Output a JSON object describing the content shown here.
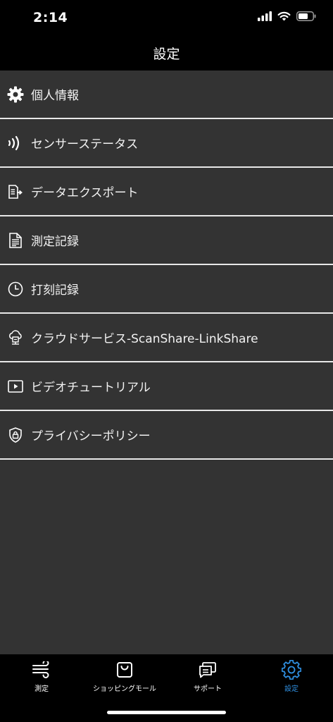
{
  "status_bar": {
    "time": "2:14"
  },
  "nav": {
    "title": "設定"
  },
  "menu": [
    {
      "label": "個人情報",
      "icon": "gear-icon"
    },
    {
      "label": "センサーステータス",
      "icon": "signal-waves-icon"
    },
    {
      "label": "データエクスポート",
      "icon": "export-icon"
    },
    {
      "label": "測定記録",
      "icon": "document-icon"
    },
    {
      "label": "打刻記録",
      "icon": "clock-icon"
    },
    {
      "label": "クラウドサービス-ScanShare-LinkShare",
      "icon": "cloud-service-icon"
    },
    {
      "label": "ビデオチュートリアル",
      "icon": "video-icon"
    },
    {
      "label": "プライバシーポリシー",
      "icon": "shield-lock-icon"
    }
  ],
  "tabs": [
    {
      "label": "測定",
      "icon": "wind-icon",
      "active": false
    },
    {
      "label": "ショッピングモール",
      "icon": "shopping-bag-icon",
      "active": false
    },
    {
      "label": "サポート",
      "icon": "chat-bubbles-icon",
      "active": false
    },
    {
      "label": "設定",
      "icon": "gear-icon",
      "active": true
    }
  ],
  "colors": {
    "background": "#000000",
    "content_background": "#333333",
    "divider": "#e8e8e8",
    "active_tab": "#2f8fe0"
  }
}
